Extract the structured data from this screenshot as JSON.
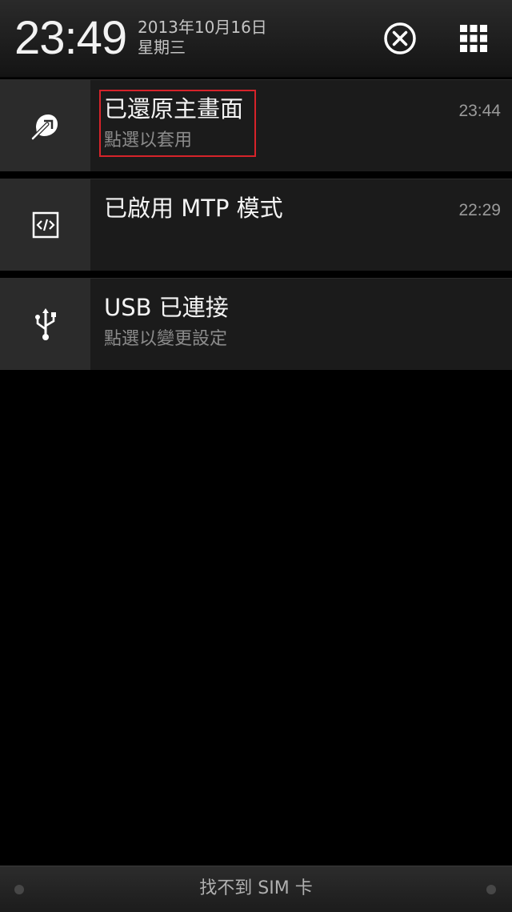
{
  "status_header": {
    "time": "23:49",
    "date": "2013年10月16日",
    "weekday": "星期三",
    "clear_icon": "clear-all-icon",
    "quick_settings_icon": "grid-icon"
  },
  "notifications": [
    {
      "icon": "home-restore-icon",
      "title": "已還原主畫面",
      "subtitle": "點選以套用",
      "time": "23:44",
      "highlighted": true
    },
    {
      "icon": "code-developer-icon",
      "title": "已啟用 MTP 模式",
      "subtitle": "",
      "time": "22:29"
    },
    {
      "icon": "usb-icon",
      "title": "USB 已連接",
      "subtitle": "點選以變更設定",
      "time": ""
    }
  ],
  "bottom_bar": {
    "label": "找不到 SIM 卡"
  },
  "colors": {
    "highlight_border": "#d6232a",
    "panel_bg": "#1b1b1b",
    "icon_box_bg": "#2b2b2b"
  }
}
